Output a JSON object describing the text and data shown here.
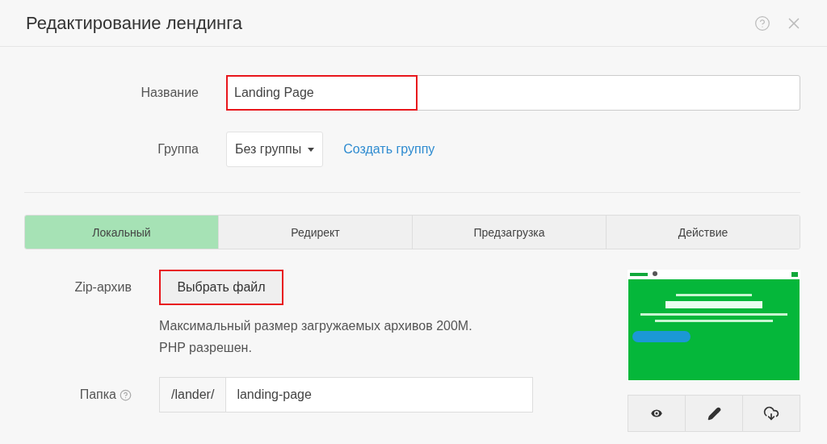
{
  "window": {
    "title": "Редактирование лендинга"
  },
  "name_field": {
    "label": "Название",
    "value": "Landing Page",
    "highlighted": true
  },
  "group_field": {
    "label": "Группа",
    "value": "Без группы",
    "link": "Создать группу"
  },
  "tabs": [
    {
      "label": "Локальный",
      "selected": true
    },
    {
      "label": "Редирект",
      "selected": false
    },
    {
      "label": "Предзагрузка",
      "selected": false
    },
    {
      "label": "Действие",
      "selected": false
    }
  ],
  "zip": {
    "label": "Zip-архив",
    "button": "Выбрать файл",
    "highlighted": true,
    "help": [
      "Максимальный размер загружаемых архивов 200M.",
      "PHP разрешен."
    ]
  },
  "folder": {
    "label": "Папка",
    "prefix": "/lander/",
    "value": "landing-page"
  }
}
